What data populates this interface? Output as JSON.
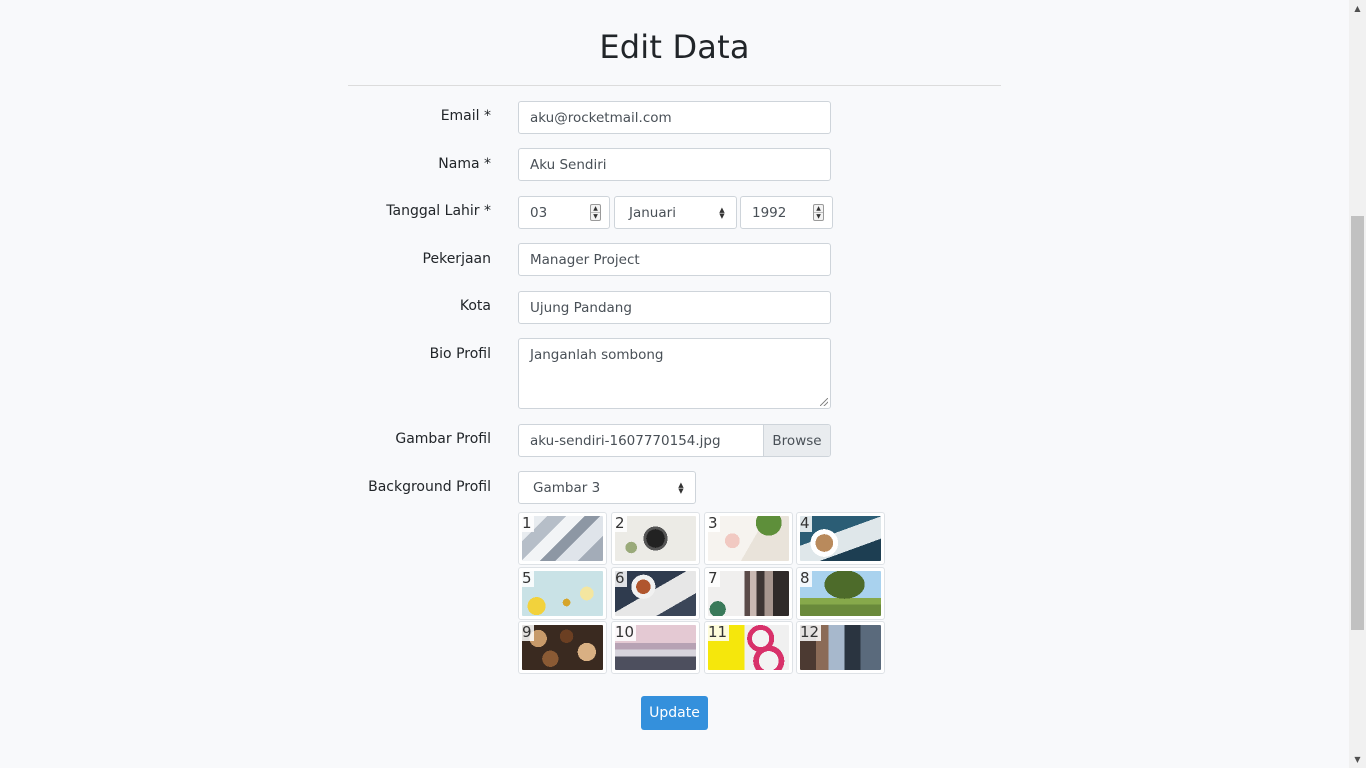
{
  "page": {
    "title": "Edit Data"
  },
  "form": {
    "email": {
      "label": "Email *",
      "value": "aku@rocketmail.com"
    },
    "nama": {
      "label": "Nama *",
      "value": "Aku Sendiri"
    },
    "tanggal_lahir": {
      "label": "Tanggal Lahir *",
      "day": "03",
      "month": "Januari",
      "year": "1992"
    },
    "pekerjaan": {
      "label": "Pekerjaan",
      "value": "Manager Project"
    },
    "kota": {
      "label": "Kota",
      "value": "Ujung Pandang"
    },
    "bio": {
      "label": "Bio Profil",
      "value": "Janganlah sombong"
    },
    "gambar": {
      "label": "Gambar Profil",
      "filename": "aku-sendiri-1607770154.jpg",
      "browse_label": "Browse"
    },
    "background": {
      "label": "Background Profil",
      "selected": "Gambar 3",
      "thumbnails": [
        "1",
        "2",
        "3",
        "4",
        "5",
        "6",
        "7",
        "8",
        "9",
        "10",
        "11",
        "12"
      ]
    },
    "submit_label": "Update"
  },
  "colors": {
    "primary": "#3490dc",
    "page_bg": "#f8f9fb"
  }
}
